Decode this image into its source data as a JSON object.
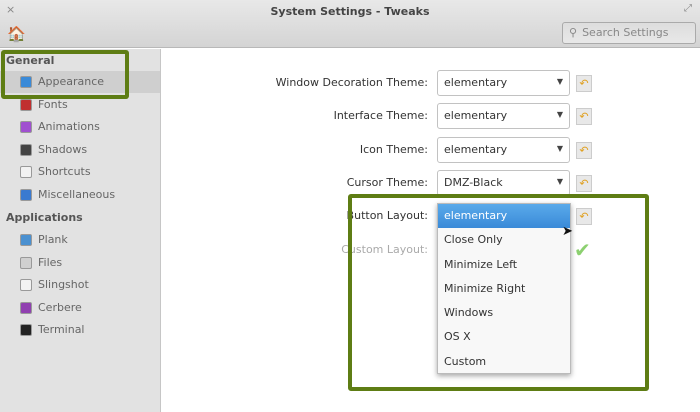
{
  "window": {
    "title": "System Settings - Tweaks",
    "close": "×",
    "maximize": "⤢"
  },
  "toolbar": {
    "home": "🏠",
    "search_placeholder": "Search Settings"
  },
  "sidebar": {
    "general": "General",
    "general_items": [
      {
        "label": "Appearance",
        "color": "#3a8ad8"
      },
      {
        "label": "Fonts",
        "color": "#c03030"
      },
      {
        "label": "Animations",
        "color": "#a050d0"
      },
      {
        "label": "Shadows",
        "color": "#444444"
      },
      {
        "label": "Shortcuts",
        "color": "#f2f2f2"
      },
      {
        "label": "Miscellaneous",
        "color": "#3a7ad0"
      }
    ],
    "applications": "Applications",
    "app_items": [
      {
        "label": "Plank",
        "color": "#4a90d0"
      },
      {
        "label": "Files",
        "color": "#d0d0d0"
      },
      {
        "label": "Slingshot",
        "color": "#f2f2f2"
      },
      {
        "label": "Cerbere",
        "color": "#9040b0"
      },
      {
        "label": "Terminal",
        "color": "#222222"
      }
    ]
  },
  "settings": [
    {
      "label": "Window Decoration Theme:",
      "value": "elementary"
    },
    {
      "label": "Interface Theme:",
      "value": "elementary"
    },
    {
      "label": "Icon Theme:",
      "value": "elementary"
    },
    {
      "label": "Cursor Theme:",
      "value": "DMZ-Black"
    },
    {
      "label": "Button Layout:",
      "value": "elementary"
    }
  ],
  "custom_layout_label": "Custom Layout:",
  "dropdown_options": [
    "elementary",
    "Close Only",
    "Minimize Left",
    "Minimize Right",
    "Windows",
    "OS X",
    "Custom"
  ],
  "highlight_color": "#5e7d14"
}
